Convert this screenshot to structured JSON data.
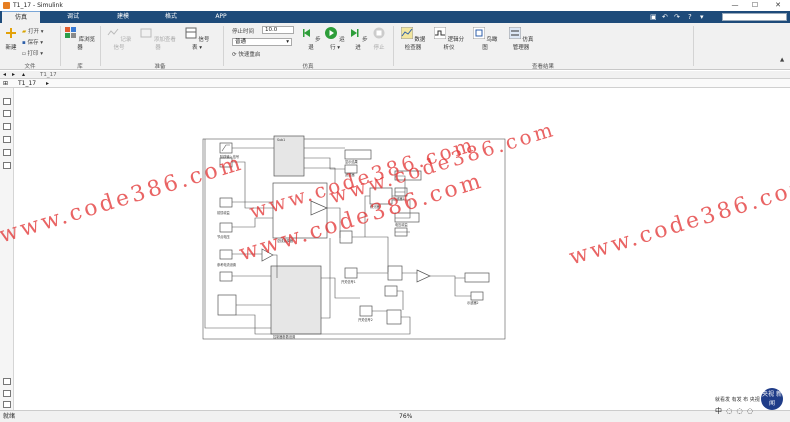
{
  "window": {
    "title": "T1_17 - Simulink",
    "minimize": "—",
    "maximize": "☐",
    "close": "✕"
  },
  "tabs": [
    {
      "label": "仿真",
      "active": true
    },
    {
      "label": "调试",
      "active": false
    },
    {
      "label": "建模",
      "active": false
    },
    {
      "label": "格式",
      "active": false
    },
    {
      "label": "APP",
      "active": false
    }
  ],
  "ribbon": {
    "file": {
      "new_label": "新建",
      "open_label": "打开",
      "save_label": "保存",
      "print_label": "打印",
      "section": "文件"
    },
    "library": {
      "browser_label": "库浏览器",
      "section": "库"
    },
    "prepare": {
      "signal_table": "信号表",
      "log_signals": "记录信号",
      "add_viewer": "添加查看器",
      "section": "准备"
    },
    "simulate": {
      "stop_time_label": "停止时间",
      "stop_time_value": "10.0",
      "mode_value": "普通",
      "fast_restart": "快速重启",
      "step_back": "步退",
      "run": "运行",
      "step_forward": "步进",
      "stop": "停止",
      "section": "仿真"
    },
    "review": {
      "data_inspector": "数据检查器",
      "logic_analyzer": "逻辑分析仪",
      "bird_eye": "鸟瞰图",
      "sim_manager": "仿真管理器",
      "section": "查看结果"
    }
  },
  "address": {
    "breadcrumb_sub": "T1_17",
    "path": "T1_17"
  },
  "status": {
    "left": "就绪",
    "zoom": "76%"
  },
  "watermark": {
    "text": "www.code386.com"
  },
  "logo": {
    "badge": "央视 新闻",
    "line1": "就看发 有发 布 央视",
    "line2": "中 ◌ ◌ ◌"
  },
  "diagram": {
    "labels": [
      "阶跃输入信号",
      "Sub1",
      "前馈增益",
      "节点电压",
      "参考电流设置",
      "总线选择器",
      "滤波器",
      "积分器",
      "显示结果",
      "电压增益",
      "控制器参数设置",
      "开关信号1",
      "开关信号2",
      "示波器1",
      "示波器2"
    ]
  },
  "colors": {
    "tabbar": "#1e4b7a",
    "watermark": "#e12828",
    "play": "#2e9e3a"
  }
}
